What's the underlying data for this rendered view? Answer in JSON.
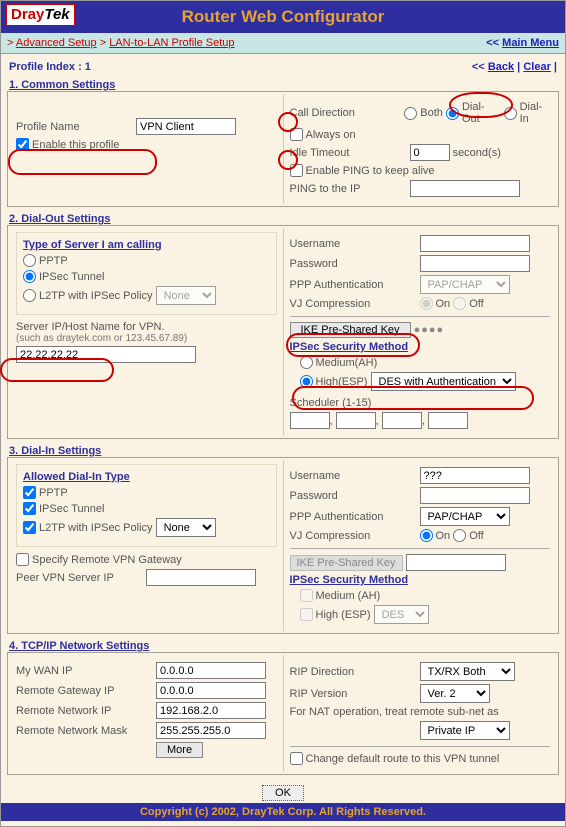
{
  "header": {
    "logo_bold": "Dray",
    "logo_rest": "Tek",
    "title": "Router Web Configurator"
  },
  "crumb": {
    "left": [
      "Advanced Setup",
      "LAN-to-LAN Profile Setup"
    ],
    "sep": ">",
    "main_prefix": "<< ",
    "main": "Main Menu"
  },
  "index": {
    "label": "Profile Index : 1",
    "back": "Back",
    "clear": "Clear"
  },
  "s1": {
    "title": "1. Common Settings",
    "profile_name_label": "Profile Name",
    "profile_name_value": "VPN Client",
    "enable_label": "Enable this profile",
    "call_dir_label": "Call Direction",
    "both": "Both",
    "dialout": "Dial-Out",
    "dialin": "Dial-In",
    "always_on": "Always on",
    "idle_label": "Idle Timeout",
    "idle_value": "0",
    "seconds": "second(s)",
    "ping_keepalive": "Enable PING to keep alive",
    "ping_ip_label": "PING to the IP",
    "ping_ip_value": ""
  },
  "s2": {
    "title": "2. Dial-Out Settings",
    "typebox_title": "Type of Server I am calling",
    "pptp": "PPTP",
    "ipsec": "IPSec Tunnel",
    "l2tp": "L2TP with IPSec Policy",
    "l2tp_policy": "None",
    "server_label": "Server IP/Host Name for VPN.",
    "server_hint": "(such as draytek.com or 123.45.67.89)",
    "server_value": "22.22.22.22",
    "user_label": "Username",
    "user_value": "",
    "pass_label": "Password",
    "pass_value": "",
    "ppp_auth_label": "PPP Authentication",
    "ppp_auth_value": "PAP/CHAP",
    "vj_label": "VJ Compression",
    "on": "On",
    "off": "Off",
    "ike_btn": "IKE Pre-Shared Key",
    "ike_dots": "●●●●",
    "sec_title": "IPSec Security Method",
    "medium": "Medium(AH)",
    "high": "High(ESP)",
    "esp_value": "DES with Authentication",
    "sched_label": "Scheduler (1-15)"
  },
  "s3": {
    "title": "3. Dial-In Settings",
    "allowed_title": "Allowed Dial-In Type",
    "pptp": "PPTP",
    "ipsec": "IPSec Tunnel",
    "l2tp": "L2TP with IPSec Policy",
    "l2tp_policy": "None",
    "spec_remote": "Specify Remote VPN Gateway",
    "peer_ip_label": "Peer VPN Server IP",
    "peer_ip_value": "",
    "user_label": "Username",
    "user_value": "???",
    "pass_label": "Password",
    "pass_value": "",
    "ppp_auth_label": "PPP Authentication",
    "ppp_auth_value": "PAP/CHAP",
    "vj_label": "VJ Compression",
    "on": "On",
    "off": "Off",
    "ike_btn": "IKE Pre-Shared Key",
    "ike_value": "",
    "sec_title": "IPSec Security Method",
    "medium": "Medium (AH)",
    "high": "High (ESP)",
    "esp_value": "DES"
  },
  "s4": {
    "title": "4. TCP/IP Network Settings",
    "mywan_label": "My WAN IP",
    "mywan": "0.0.0.0",
    "rgw_label": "Remote Gateway IP",
    "rgw": "0.0.0.0",
    "rnet_label": "Remote Network IP",
    "rnet": "192.168.2.0",
    "rmask_label": "Remote Network Mask",
    "rmask": "255.255.255.0",
    "more": "More",
    "rip_dir_label": "RIP Direction",
    "rip_dir": "TX/RX Both",
    "rip_ver_label": "RIP Version",
    "rip_ver": "Ver. 2",
    "nat_text": "For NAT operation, treat remote sub-net as",
    "nat_value": "Private IP",
    "chg_route": "Change default route to this VPN tunnel"
  },
  "ok": "OK",
  "footer": "Copyright (c) 2002, DrayTek Corp. All Rights Reserved."
}
